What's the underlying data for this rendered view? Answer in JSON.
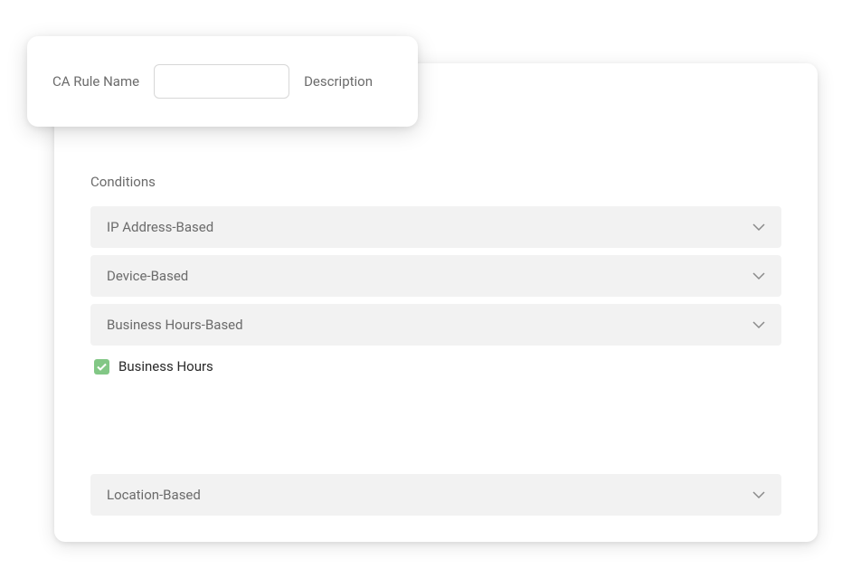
{
  "header": {
    "rule_name_label": "CA Rule Name",
    "rule_name_value": "",
    "description_label": "Description"
  },
  "conditions": {
    "title": "Conditions",
    "items": [
      {
        "label": "IP Address-Based"
      },
      {
        "label": "Device-Based"
      },
      {
        "label": "Business Hours-Based"
      }
    ],
    "business_hours_checkbox": {
      "label": "Business Hours",
      "checked": true
    },
    "location_item": {
      "label": "Location-Based"
    }
  }
}
